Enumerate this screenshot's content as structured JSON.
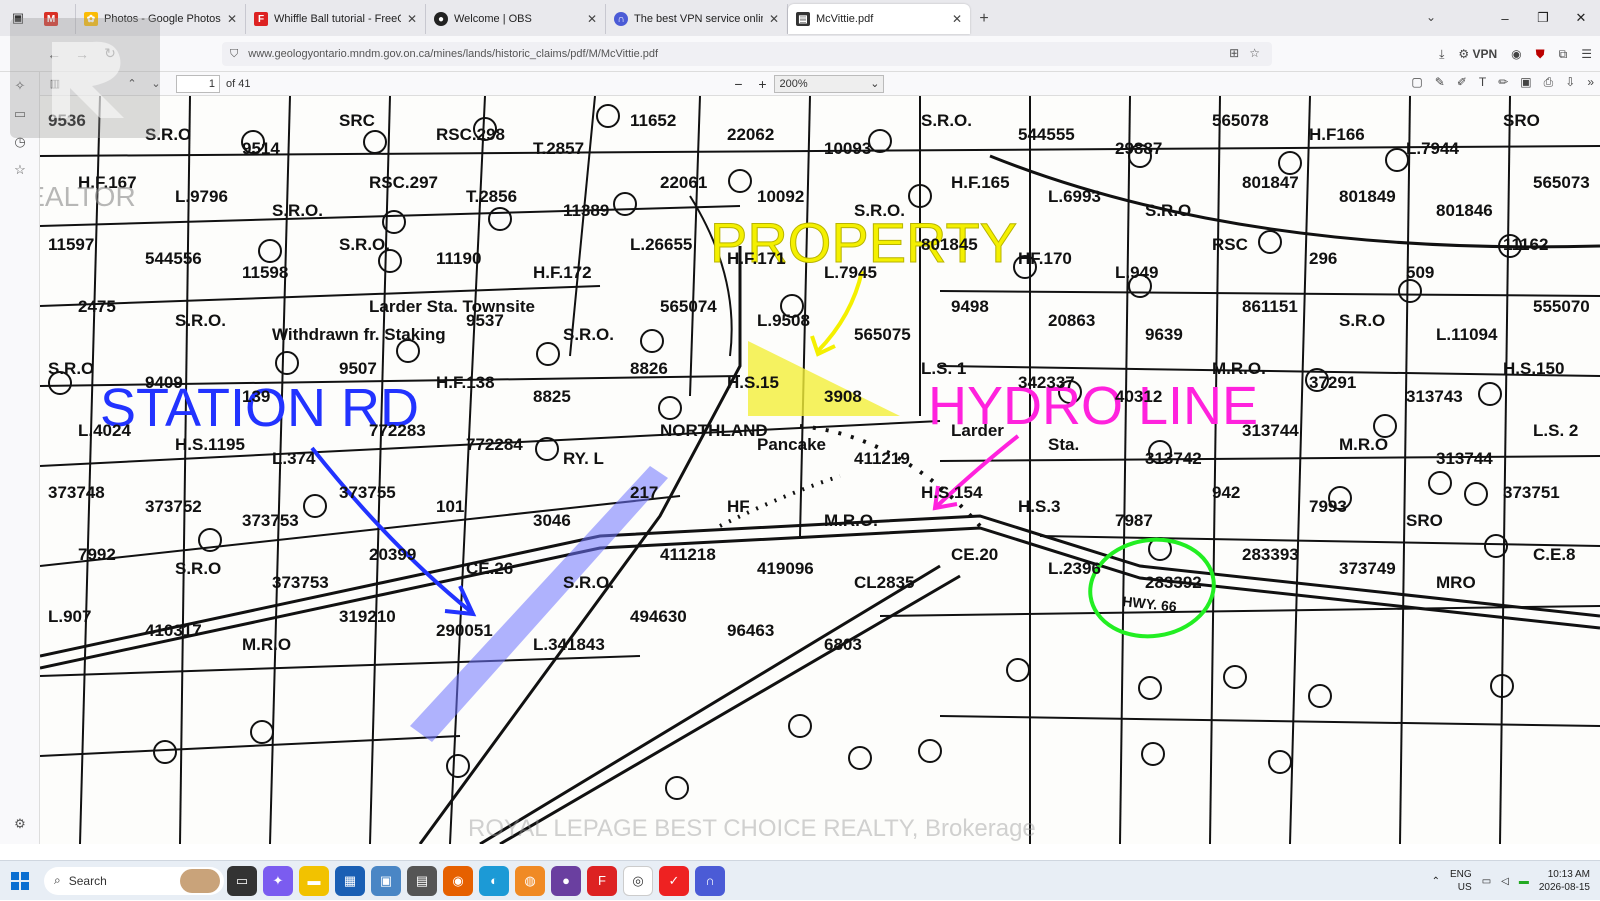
{
  "browser": {
    "tabs": [
      {
        "label": "Photos - Google Photos",
        "icon": "google-photos-icon",
        "active": false
      },
      {
        "label": "Whiffle Ball tutorial - FreeCAD D",
        "icon": "freecad-icon",
        "active": false
      },
      {
        "label": "Welcome | OBS",
        "icon": "obs-icon",
        "active": false
      },
      {
        "label": "The best VPN service online for",
        "icon": "vpn-icon",
        "active": false
      },
      {
        "label": "McVittie.pdf",
        "icon": "pdf-icon",
        "active": true
      }
    ],
    "url": "www.geologyontario.mndm.gov.on.ca/mines/lands/historic_claims/pdf/M/McVittie.pdf",
    "vpn_label": "VPN"
  },
  "pdf_toolbar": {
    "page_current": "1",
    "page_total": "of 41",
    "zoom": "200%"
  },
  "map": {
    "annotations": {
      "property": "PROPERTY",
      "station_rd": "STATION RD",
      "hydro_line": "HYDRO LINE",
      "hwy": "HWY. 66"
    },
    "labels": [
      "9536",
      "S.R.O",
      "9514",
      "SRC",
      "RSC.298",
      "T.2857",
      "11652",
      "22062",
      "10093",
      "S.R.O.",
      "544555",
      "29887",
      "565078",
      "H.F166",
      "L.7944",
      "SRO",
      "H.F.167",
      "L.9796",
      "S.R.O.",
      "RSC.297",
      "T.2856",
      "11389",
      "22061",
      "10092",
      "S.R.O.",
      "H.F.165",
      "L.6993",
      "S.R.O",
      "801847",
      "801849",
      "801846",
      "565073",
      "11597",
      "544556",
      "11598",
      "S.R.O.",
      "11190",
      "H.F.172",
      "L.26655",
      "H.F.171",
      "L.7945",
      "801845",
      "HF.170",
      "L.949",
      "RSC",
      "296",
      "509",
      "11162",
      "2475",
      "S.R.O.",
      "Withdrawn fr. Staking",
      "Larder Sta. Townsite",
      "9537",
      "S.R.O.",
      "565074",
      "L.9508",
      "565075",
      "9498",
      "20863",
      "9639",
      "861151",
      "S.R.O",
      "L.11094",
      "555070",
      "S.R.O",
      "9409",
      "139",
      "9507",
      "H.F.138",
      "8825",
      "8826",
      "H.S.15",
      "3908",
      "L.S. 1",
      "342337",
      "40312",
      "M.R.O.",
      "37291",
      "313743",
      "H.S.150",
      "L.4024",
      "H.S.1195",
      "L.374",
      "772283",
      "772284",
      "RY. L",
      "NORTHLAND",
      "Pancake",
      "411219",
      "Larder",
      "Sta.",
      "313742",
      "313744",
      "M.R.O",
      "313744",
      "L.S. 2",
      "373748",
      "373752",
      "373753",
      "373755",
      "101",
      "3046",
      "217",
      "HF",
      "M.R.O.",
      "H.S.154",
      "H.S.3",
      "7987",
      "942",
      "7993",
      "SRO",
      "373751",
      "7992",
      "S.R.O",
      "373753",
      "20399",
      "CE.26",
      "S.R.O.",
      "411218",
      "419096",
      "CL2835",
      "CE.20",
      "L.2396",
      "283392",
      "283393",
      "373749",
      "MRO",
      "C.E.8",
      "L.907",
      "410317",
      "M.R.O",
      "319210",
      "290051",
      "L.341843",
      "494630",
      "96463",
      "6803"
    ],
    "overlay_watermark": "REALTOR",
    "bottom_watermark": "ROYAL LEPAGE BEST CHOICE REALTY, Brokerage"
  },
  "taskbar": {
    "search_placeholder": "Search",
    "lang_top": "ENG",
    "lang_bottom": "US",
    "time": "10:13 AM",
    "date": "2026-08-15"
  },
  "colors": {
    "property": "#f4f000",
    "property_fill": "#f3ef3a",
    "station": "#2233ff",
    "hydro": "#ff22dd",
    "hwy_circle": "#22ee22",
    "rail_highlight": "#6f74ff"
  }
}
